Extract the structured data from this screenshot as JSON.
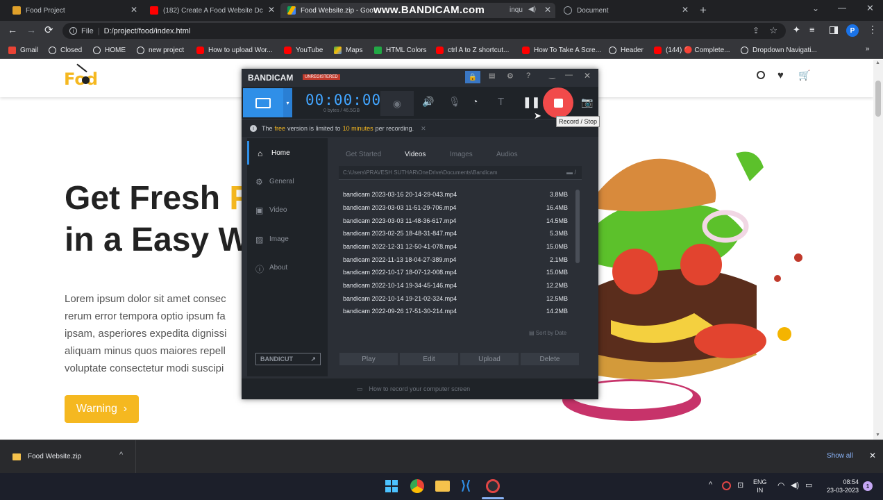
{
  "browser": {
    "tabs": [
      {
        "title": "Food Project",
        "favcolor": "#e0a12a"
      },
      {
        "title": "(182) Create A Food Website Dc",
        "favcolor": "#ff0000"
      },
      {
        "title": "Food Website.zip - Goo",
        "favcolor": "#4285f4"
      },
      {
        "title": "Document",
        "favcolor": "#9aa0a6"
      }
    ],
    "bandicam_watermark": "www.BANDICAM.com",
    "watermark_tail": "inqu",
    "url_scheme": "File",
    "url": "D:/project/food/index.html",
    "profile_initial": "P",
    "bookmarks": [
      {
        "label": "Gmail",
        "color": "#ea4335"
      },
      {
        "label": "Closed",
        "color": "#e8eaed"
      },
      {
        "label": "HOME",
        "color": "#e8eaed"
      },
      {
        "label": "new project",
        "color": "#e8eaed"
      },
      {
        "label": "How to upload Wor...",
        "color": "#ff0000"
      },
      {
        "label": "YouTube",
        "color": "#ff0000"
      },
      {
        "label": "Maps",
        "color": "#34a853"
      },
      {
        "label": "HTML Colors",
        "color": "#22a845"
      },
      {
        "label": "ctrl A to Z shortcut...",
        "color": "#ff0000"
      },
      {
        "label": "How To Take A Scre...",
        "color": "#ff0000"
      },
      {
        "label": "Header",
        "color": "#e8eaed"
      },
      {
        "label": "(144) 🔴 Complete...",
        "color": "#ff0000"
      },
      {
        "label": "Dropdown Navigati...",
        "color": "#e8eaed"
      }
    ]
  },
  "site": {
    "logo_f": "F",
    "logo_rest": "od",
    "hero_line1": "Get Fresh",
    "hero_line1_accent": "F",
    "hero_line2": "in a Easy W",
    "paragraph": [
      "Lorem ipsum dolor sit amet consec",
      "rerum error tempora optio ipsum fa",
      "ipsam, asperiores expedita dignissi",
      "aliquam minus quos maiores repell",
      "voluptate consectetur modi suscipi"
    ],
    "cta": "Warning",
    "accent": "#f5b820"
  },
  "bandicam": {
    "brand": "BANDICAM",
    "badge": "UNREGISTERED",
    "timer": "00:00:00",
    "size": "0 bytes / 46.5GB",
    "notice_pre": "The ",
    "notice_free": "free",
    "notice_mid": " version is limited to ",
    "notice_min": "10 minutes",
    "notice_post": " per recording.",
    "tooltip": "Record / Stop",
    "sidebar": [
      "Home",
      "General",
      "Video",
      "Image",
      "About"
    ],
    "tabs": [
      "Get Started",
      "Videos",
      "Images",
      "Audios"
    ],
    "path": "C:\\Users\\PRAVESH SUTHAR\\OneDrive\\Documents\\Bandicam",
    "files": [
      {
        "name": "bandicam 2023-03-16 20-14-29-043.mp4",
        "size": "3.8MB"
      },
      {
        "name": "bandicam 2023-03-03 11-51-29-706.mp4",
        "size": "16.4MB"
      },
      {
        "name": "bandicam 2023-03-03 11-48-36-617.mp4",
        "size": "14.5MB"
      },
      {
        "name": "bandicam 2023-02-25 18-48-31-847.mp4",
        "size": "5.3MB"
      },
      {
        "name": "bandicam 2022-12-31 12-50-41-078.mp4",
        "size": "15.0MB"
      },
      {
        "name": "bandicam 2022-11-13 18-04-27-389.mp4",
        "size": "2.1MB"
      },
      {
        "name": "bandicam 2022-10-17 18-07-12-008.mp4",
        "size": "15.0MB"
      },
      {
        "name": "bandicam 2022-10-14 19-34-45-146.mp4",
        "size": "12.2MB"
      },
      {
        "name": "bandicam 2022-10-14 19-21-02-324.mp4",
        "size": "12.5MB"
      },
      {
        "name": "bandicam 2022-09-26 17-51-30-214.mp4",
        "size": "14.2MB"
      }
    ],
    "sort": "Sort by Date",
    "actions": [
      "Play",
      "Edit",
      "Upload",
      "Delete"
    ],
    "bandicut": "BANDICUT",
    "footer": "How to record your computer screen"
  },
  "download": {
    "file": "Food Website.zip",
    "show_all": "Show all"
  },
  "taskbar": {
    "lang1": "ENG",
    "lang2": "IN",
    "time": "08:54",
    "date": "23-03-2023",
    "notif": "1"
  }
}
